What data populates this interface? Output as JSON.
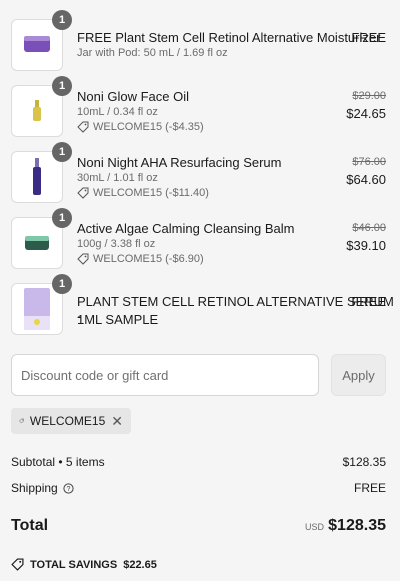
{
  "items": [
    {
      "qty": "1",
      "name": "FREE Plant Stem Cell Retinol Alternative Moisturizer",
      "variant": "Jar with Pod: 50 mL / 1.69 fl oz",
      "price": "FREE"
    },
    {
      "qty": "1",
      "name": "Noni Glow Face Oil",
      "variant": "10mL / 0.34 fl oz",
      "discount": "WELCOME15 (-$4.35)",
      "original_price": "$29.00",
      "price": "$24.65"
    },
    {
      "qty": "1",
      "name": "Noni Night AHA Resurfacing Serum",
      "variant": "30mL / 1.01 fl oz",
      "discount": "WELCOME15 (-$11.40)",
      "original_price": "$76.00",
      "price": "$64.60"
    },
    {
      "qty": "1",
      "name": "Active Algae Calming Cleansing Balm",
      "variant": "100g / 3.38 fl oz",
      "discount": "WELCOME15 (-$6.90)",
      "original_price": "$46.00",
      "price": "$39.10"
    },
    {
      "qty": "1",
      "name_line1": "PLANT STEM CELL RETINOL ALTERNATIVE SERUM -",
      "name_line2": "1ML SAMPLE",
      "price": "FREE"
    }
  ],
  "discount": {
    "placeholder": "Discount code or gift card",
    "apply_label": "Apply",
    "applied_code": "WELCOME15"
  },
  "summary": {
    "subtotal_label": "Subtotal • 5 items",
    "subtotal_value": "$128.35",
    "shipping_label": "Shipping",
    "shipping_value": "FREE",
    "total_label": "Total",
    "currency": "USD",
    "total_value": "$128.35",
    "savings_label": "TOTAL SAVINGS",
    "savings_value": "$22.65"
  },
  "colors": {
    "background": "#f5f5f5",
    "badge": "#666666"
  }
}
